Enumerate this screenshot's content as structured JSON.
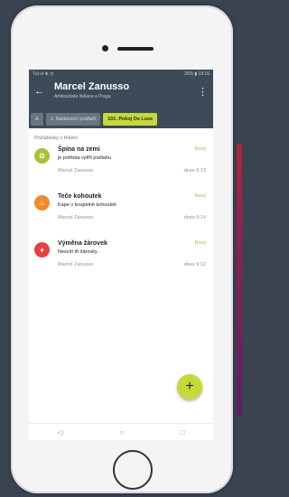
{
  "status": {
    "left": "Tul ul ⊕ ◷",
    "right": "25% ▮ 19:16"
  },
  "appbar": {
    "title": "Marcel Zanusso",
    "subtitle": "Ambasciata Italiana a Praga"
  },
  "tabs": [
    {
      "label": "A"
    },
    {
      "label": "1. Nadzemní podlaží"
    },
    {
      "label": "101. Pokoj De Luxe"
    }
  ],
  "section_title": "Požadavky v řešení",
  "colors": {
    "accent": "#c5d93a",
    "appbar": "#3d4a58"
  },
  "items": [
    {
      "title": "Špína na zemi",
      "desc": "je potřeba vytřít podlahu",
      "status": "Nový",
      "user": "Marcel Zanusso",
      "time": "dnes 9:13",
      "icon": "leaf-icon",
      "color": "#a6c232"
    },
    {
      "title": "Teče kohoutek",
      "desc": "Kape v koupelně kohoutek",
      "status": "Nový",
      "user": "Marcel Zanusso",
      "time": "dnes 9:14",
      "icon": "water-drop-icon",
      "color": "#f08a2c"
    },
    {
      "title": "Výměna žárovek",
      "desc": "Nesvítí tři žárovky",
      "status": "Nový",
      "user": "Marcel Zanusso",
      "time": "dnes 9:12",
      "icon": "fire-icon",
      "color": "#e5423b"
    }
  ],
  "fab": {
    "label": "+"
  },
  "nav": {
    "back": "◁",
    "home": "○",
    "recent": "□"
  }
}
